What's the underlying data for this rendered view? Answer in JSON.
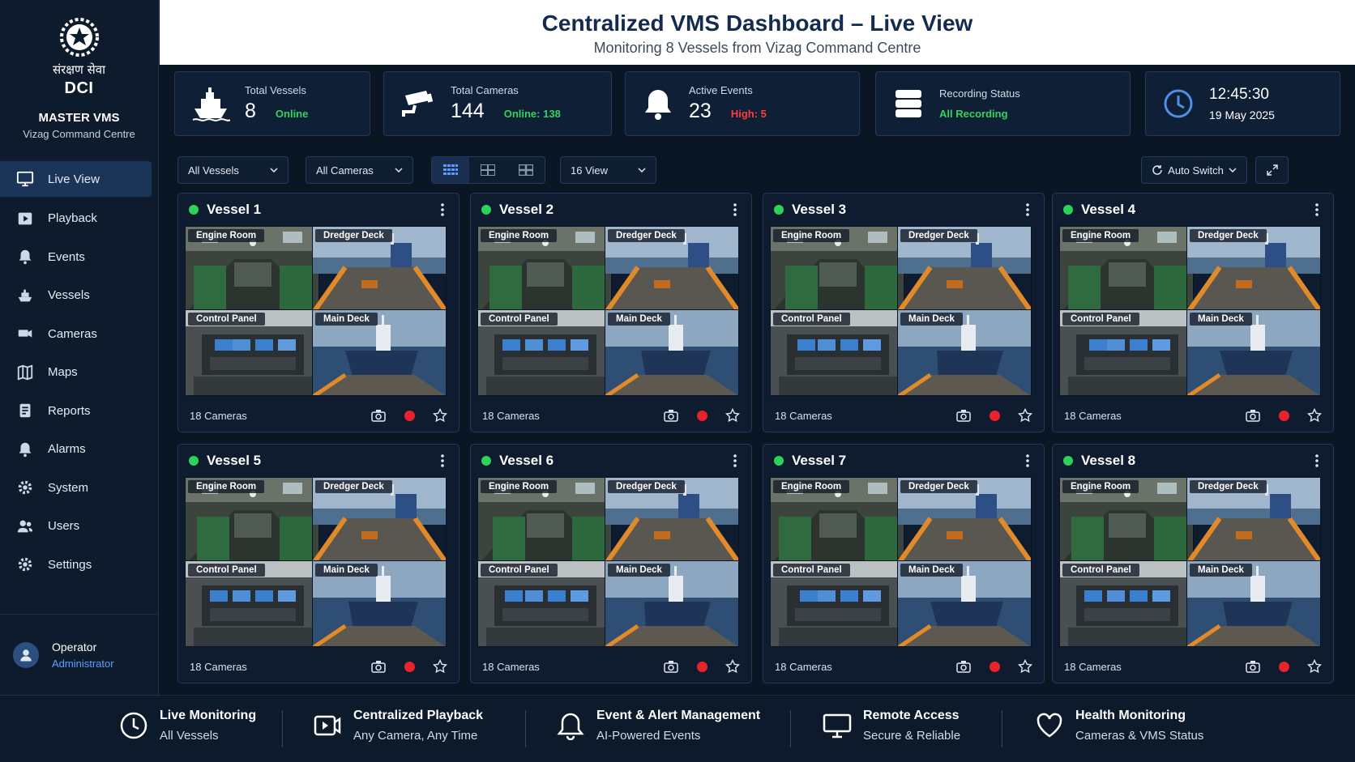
{
  "brand": {
    "hindi": "संरक्षण सेवा",
    "name": "DCI",
    "title": "MASTER VMS",
    "subtitle": "Vizag Command Centre"
  },
  "nav": [
    {
      "label": "Live View",
      "icon": "monitor-icon",
      "active": true
    },
    {
      "label": "Playback",
      "icon": "play-icon"
    },
    {
      "label": "Events",
      "icon": "bell-icon"
    },
    {
      "label": "Vessels",
      "icon": "ship-icon"
    },
    {
      "label": "Cameras",
      "icon": "camera-icon"
    },
    {
      "label": "Maps",
      "icon": "map-icon"
    },
    {
      "label": "Reports",
      "icon": "report-icon"
    },
    {
      "label": "Alarms",
      "icon": "alarm-icon"
    },
    {
      "label": "System",
      "icon": "gear-icon"
    },
    {
      "label": "Users",
      "icon": "users-icon"
    },
    {
      "label": "Settings",
      "icon": "settings-icon"
    }
  ],
  "user": {
    "name": "Operator",
    "role": "Administrator"
  },
  "header": {
    "title": "Centralized VMS Dashboard – Live View",
    "subtitle": "Monitoring 8 Vessels from Vizag Command Centre"
  },
  "kpis": {
    "vessels": {
      "label": "Total Vessels",
      "value": "8",
      "sub": "Online"
    },
    "cameras": {
      "label": "Total Cameras",
      "value": "144",
      "sub": "Online: 138"
    },
    "events": {
      "label": "Active Events",
      "value": "23",
      "sub": "High: 5"
    },
    "recording": {
      "label": "Recording Status",
      "sub": "All Recording"
    },
    "clock": {
      "time": "12:45:30",
      "date": "19 May 2025"
    }
  },
  "toolbar": {
    "vessel_filter": "All Vessels",
    "camera_filter": "All Cameras",
    "view_select": "16 View",
    "auto_switch": "Auto Switch"
  },
  "camera_labels": [
    "Engine Room",
    "Dredger Deck",
    "Control Panel",
    "Main Deck"
  ],
  "vessels": [
    {
      "name": "Vessel 1",
      "cameras": "18 Cameras"
    },
    {
      "name": "Vessel 2",
      "cameras": "18 Cameras"
    },
    {
      "name": "Vessel 3",
      "cameras": "18 Cameras"
    },
    {
      "name": "Vessel 4",
      "cameras": "18 Cameras"
    },
    {
      "name": "Vessel 5",
      "cameras": "18 Cameras"
    },
    {
      "name": "Vessel 6",
      "cameras": "18 Cameras"
    },
    {
      "name": "Vessel 7",
      "cameras": "18 Cameras"
    },
    {
      "name": "Vessel 8",
      "cameras": "18 Cameras"
    }
  ],
  "features": [
    {
      "title": "Live Monitoring",
      "sub": "All Vessels"
    },
    {
      "title": "Centralized Playback",
      "sub": "Any Camera, Any Time"
    },
    {
      "title": "Event & Alert Management",
      "sub": "AI-Powered Events"
    },
    {
      "title": "Remote Access",
      "sub": "Secure & Reliable"
    },
    {
      "title": "Health Monitoring",
      "sub": "Cameras & VMS Status"
    }
  ],
  "colors": {
    "online": "#33d35f",
    "alert": "#ff3b3b",
    "accent": "#1b3558",
    "recording": "#e8232b"
  }
}
